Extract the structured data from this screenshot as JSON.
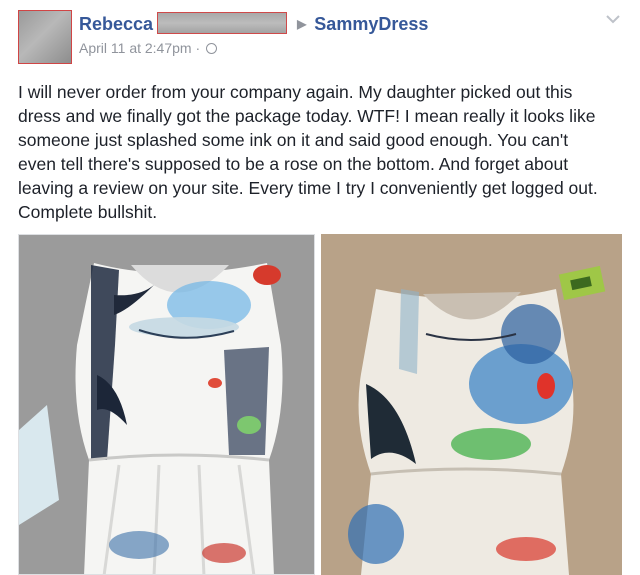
{
  "post": {
    "author_name": "Rebecca",
    "target_page": "SammyDress",
    "timestamp": "April 11 at 2:47pm",
    "separator": "·",
    "privacy_icon": "globe-icon",
    "options_icon": "chevron-down-icon",
    "body_lines": [
      "I will never order from your company again. My daughter picked out this",
      "dress and we finally got the package today. WTF! I mean really it looks like",
      "someone just splashed some ink on it and said good enough. You can't",
      "even tell there's supposed to be a rose on the bottom. And forget about",
      "leaving a review on your site. Every time I try I conveniently get logged out.",
      "Complete bullshit."
    ]
  },
  "colors": {
    "link_blue": "#365899",
    "meta_gray": "#90949c",
    "text": "#1d2129",
    "redaction_border": "#cf4a4a"
  }
}
